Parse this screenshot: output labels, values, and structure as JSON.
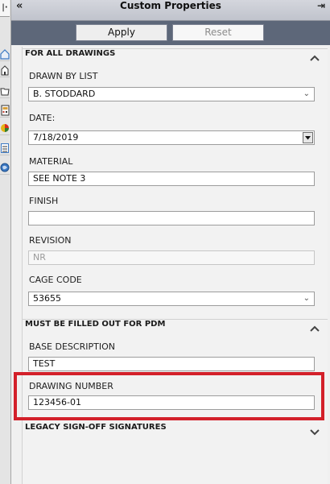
{
  "panel": {
    "title": "Custom Properties",
    "collapse_glyph": "«",
    "pin_glyph": "⇥",
    "left_button_glyph": "|·"
  },
  "buttons": {
    "apply": "Apply",
    "reset": "Reset"
  },
  "sections": [
    {
      "title": "FOR ALL DRAWINGS",
      "expanded": true,
      "fields": [
        {
          "label": "DRAWN BY LIST",
          "value": "B. STODDARD",
          "type": "combo"
        },
        {
          "label": "DATE:",
          "value": "7/18/2019",
          "type": "date"
        },
        {
          "label": "MATERIAL",
          "value": "SEE NOTE 3",
          "type": "text"
        },
        {
          "label": "FINISH",
          "value": "",
          "type": "text"
        },
        {
          "label": "REVISION",
          "value": "NR",
          "type": "text-disabled"
        },
        {
          "label": "CAGE CODE",
          "value": "53655",
          "type": "combo"
        }
      ]
    },
    {
      "title": "MUST BE FILLED OUT FOR PDM",
      "expanded": true,
      "fields": [
        {
          "label": "BASE DESCRIPTION",
          "value": "TEST",
          "type": "text"
        },
        {
          "label": "DRAWING NUMBER",
          "value": "123456-01",
          "type": "text",
          "highlighted": true
        }
      ]
    },
    {
      "title": "LEGACY SIGN-OFF SIGNATURES",
      "expanded": false,
      "fields": []
    }
  ],
  "left_toolbar_icons": [
    "home-icon",
    "house-icon",
    "folder-icon",
    "calculator-icon",
    "pie-chart-icon",
    "list-icon",
    "globe-icon"
  ],
  "colors": {
    "highlight": "#d3202a",
    "button_bar": "#5d6779",
    "accent_blue": "#3a78c3"
  }
}
